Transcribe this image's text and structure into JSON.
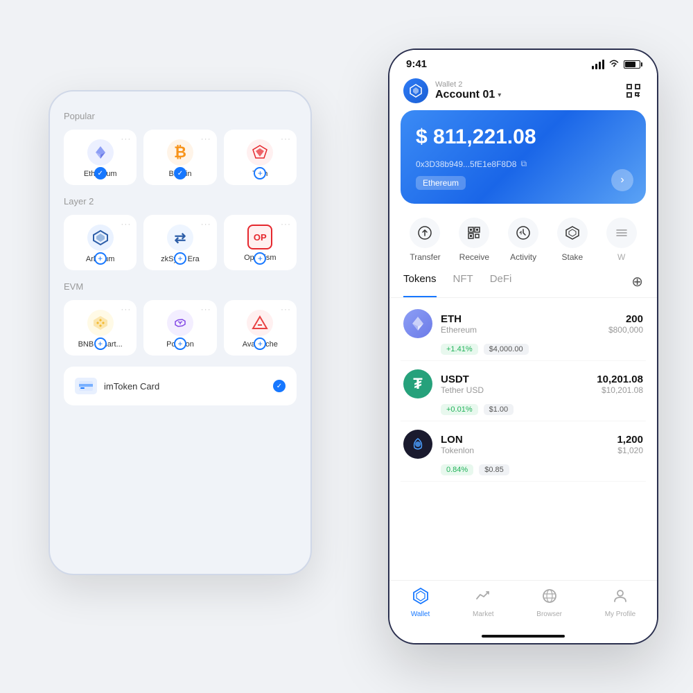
{
  "left_phone": {
    "sections": [
      {
        "title": "Popular",
        "networks": [
          {
            "name": "Ethereum",
            "icon": "◈",
            "icon_class": "eth-icon",
            "icon_color": "#6c7be8",
            "badge": "check"
          },
          {
            "name": "Bitcoin",
            "icon": "₿",
            "icon_class": "btc-icon",
            "icon_color": "#f7931a",
            "badge": "check"
          },
          {
            "name": "Tron",
            "icon": "▶",
            "icon_class": "tron-icon",
            "icon_color": "#e5272d",
            "badge": "add"
          }
        ]
      },
      {
        "title": "Layer 2",
        "networks": [
          {
            "name": "Arbitrum",
            "icon": "⬡",
            "icon_class": "arb-icon",
            "icon_color": "#2d5ea8",
            "badge": "add"
          },
          {
            "name": "zkSync Era",
            "icon": "⇄",
            "icon_class": "zk-icon",
            "icon_color": "#2d5ea8",
            "badge": "add"
          },
          {
            "name": "Optimism",
            "icon": "OP",
            "icon_class": "opt-icon",
            "icon_color": "#e5272d",
            "badge": "add"
          }
        ]
      },
      {
        "title": "EVM",
        "networks": [
          {
            "name": "BNB Smart...",
            "icon": "⬡",
            "icon_class": "bnb-icon",
            "icon_color": "#f3ba2f",
            "badge": "add"
          },
          {
            "name": "Polygon",
            "icon": "⬡",
            "icon_class": "poly-icon",
            "icon_color": "#8247e5",
            "badge": "add"
          },
          {
            "name": "Avalanche",
            "icon": "▲",
            "icon_class": "avax-icon",
            "icon_color": "#e84142",
            "badge": "add"
          }
        ]
      }
    ],
    "imtoken_card": {
      "name": "imToken Card",
      "badge": "check"
    }
  },
  "right_phone": {
    "status_bar": {
      "time": "9:41",
      "show_signal": true,
      "show_wifi": true,
      "show_battery": true
    },
    "header": {
      "wallet_label": "Wallet 2",
      "account_name": "Account 01",
      "scan_icon": "⊡"
    },
    "balance_card": {
      "amount": "$ 811,221.08",
      "address": "0x3D38b949...5fE1e8F8D8",
      "network": "Ethereum"
    },
    "actions": [
      {
        "label": "Transfer",
        "icon": "↑"
      },
      {
        "label": "Receive",
        "icon": "⊞"
      },
      {
        "label": "Activity",
        "icon": "⏱"
      },
      {
        "label": "Stake",
        "icon": "◇"
      },
      {
        "label": "W",
        "icon": "≡"
      }
    ],
    "tabs": [
      {
        "label": "Tokens",
        "active": true
      },
      {
        "label": "NFT",
        "active": false
      },
      {
        "label": "DeFi",
        "active": false
      }
    ],
    "tokens": [
      {
        "symbol": "ETH",
        "name": "Ethereum",
        "amount": "200",
        "usd_value": "$800,000",
        "change": "+1.41%",
        "price": "$4,000.00",
        "change_positive": true
      },
      {
        "symbol": "USDT",
        "name": "Tether USD",
        "amount": "10,201.08",
        "usd_value": "$10,201.08",
        "change": "+0.01%",
        "price": "$1.00",
        "change_positive": true
      },
      {
        "symbol": "LON",
        "name": "Tokenlon",
        "amount": "1,200",
        "usd_value": "$1,020",
        "change": "0.84%",
        "price": "$0.85",
        "change_positive": true
      }
    ],
    "bottom_nav": [
      {
        "label": "Wallet",
        "active": true,
        "icon": "◎"
      },
      {
        "label": "Market",
        "active": false,
        "icon": "↗"
      },
      {
        "label": "Browser",
        "active": false,
        "icon": "⊙"
      },
      {
        "label": "My Profile",
        "active": false,
        "icon": "👤"
      }
    ]
  }
}
